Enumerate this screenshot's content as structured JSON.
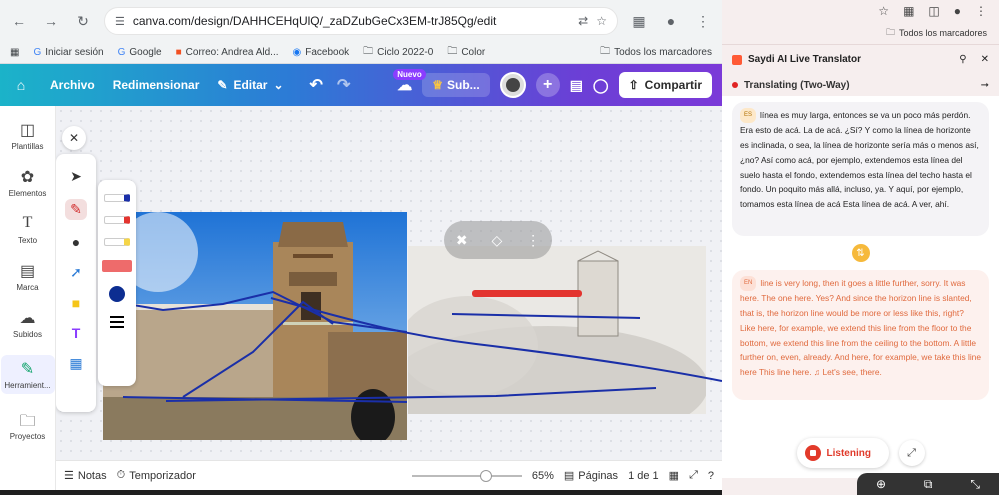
{
  "browser": {
    "url": "canva.com/design/DAHHCEHqUlQ/_zaDZubGeCx3EM-trJ85Qg/edit",
    "bookmarks": [
      {
        "label": "Iniciar sesión",
        "icon": "google-g-icon"
      },
      {
        "label": "Google",
        "icon": "google-g-icon"
      },
      {
        "label": "Correo: Andrea Ald...",
        "icon": "microsoft-icon"
      },
      {
        "label": "Facebook",
        "icon": "facebook-icon"
      },
      {
        "label": "Ciclo 2022-0",
        "icon": "folder-icon"
      },
      {
        "label": "Color",
        "icon": "folder-icon"
      }
    ],
    "all_bookmarks": "Todos los marcadores"
  },
  "canva": {
    "menu": {
      "archivo": "Archivo",
      "redimensionar": "Redimensionar",
      "editar": "Editar"
    },
    "nuevo_badge": "Nuevo",
    "sub_label": "Sub...",
    "share_label": "Compartir",
    "sidebar": [
      {
        "label": "Plantillas",
        "icon": "templates-icon"
      },
      {
        "label": "Elementos",
        "icon": "elements-icon"
      },
      {
        "label": "Texto",
        "icon": "text-icon"
      },
      {
        "label": "Marca",
        "icon": "brand-icon"
      },
      {
        "label": "Subidos",
        "icon": "uploads-icon"
      },
      {
        "label": "Herramient...",
        "icon": "draw-tools-icon"
      },
      {
        "label": "Proyectos",
        "icon": "projects-icon"
      }
    ],
    "bottom": {
      "notas": "Notas",
      "temporizador": "Temporizador",
      "zoom": "65%",
      "zoom_fraction": 0.65,
      "paginas": "Páginas",
      "page_count": "1 de 1"
    },
    "colors": {
      "pen_blue": "#1a2fa8",
      "pen_red": "#e3342f",
      "pen_yellow": "#f5d547",
      "highlighter_red": "#ee6b6b",
      "active_color": "#0c2d91"
    }
  },
  "extension": {
    "title": "Saydi AI Live Translator",
    "mode": "Translating (Two-Way)",
    "es_tag": "ES",
    "en_tag": "EN",
    "es_text": "línea es muy larga, entonces se va un poco más perdón. Era esto de acá. La de acá. ¿Sí? Y como la línea de horizonte es inclinada, o sea, la línea de horizonte sería más o menos así, ¿no? Así como acá, por ejemplo, extendemos esta línea del suelo hasta el fondo, extendemos esta línea del techo hasta el fondo. Un poquito más allá, incluso, ya. Y aquí, por ejemplo, tomamos esta línea de acá Esta línea de acá.  A ver, ahí.",
    "en_text": "line is very long, then it goes a little further, sorry. It was here. The one here. Yes? And since the horizon line is slanted, that is, the horizon line would be more or less like this, right? Like here, for example, we extend this line from the floor to the bottom, we extend this line from the ceiling to the bottom. A little further on, even, already. And here, for example, we take this line here This line here. ♫ Let's see, there.",
    "listen_label": "Listening"
  }
}
